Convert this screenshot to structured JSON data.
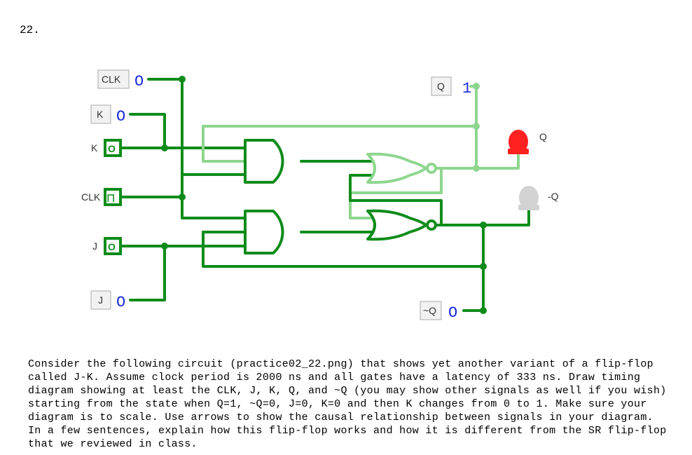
{
  "question_number": "22.",
  "question_text": "Consider the following circuit (practice02_22.png) that shows yet another variant of a flip-flop called J-K. Assume clock period is 2000 ns and all gates have a latency of 333 ns. Draw timing diagram showing at least the CLK, J, K, Q, and ~Q (you may show other signals as well if you wish) starting from the state when Q=1, ~Q=0, J=0, K=0 and then K changes from 0 to 1. Make sure your diagram is to scale. Use arrows to show the causal relationship between signals in your diagram. In a few sentences, explain how this flip-flop works and how it is different from the SR flip-flop that we reviewed in class.",
  "circuit": {
    "inputs": {
      "clk": {
        "label": "CLK",
        "value": "O"
      },
      "k": {
        "label": "K",
        "value": "O"
      },
      "j": {
        "label": "J",
        "value": "O"
      }
    },
    "outputs": {
      "q": {
        "label": "Q",
        "value": "1"
      },
      "notq": {
        "label": "~Q",
        "value": "O"
      }
    },
    "pins": {
      "k_pin": {
        "label": "K",
        "glyph": "O"
      },
      "clk_pin": {
        "label": "CLK",
        "glyph": "⨅"
      },
      "j_pin": {
        "label": "J",
        "glyph": "O"
      }
    },
    "leds": {
      "q_led": {
        "label": "Q",
        "on": true
      },
      "notq_led": {
        "label": "-Q",
        "on": false
      }
    },
    "gates": {
      "and_top": "AND",
      "and_bottom": "AND",
      "nor_top": "NOR",
      "nor_bottom": "NOR"
    }
  }
}
